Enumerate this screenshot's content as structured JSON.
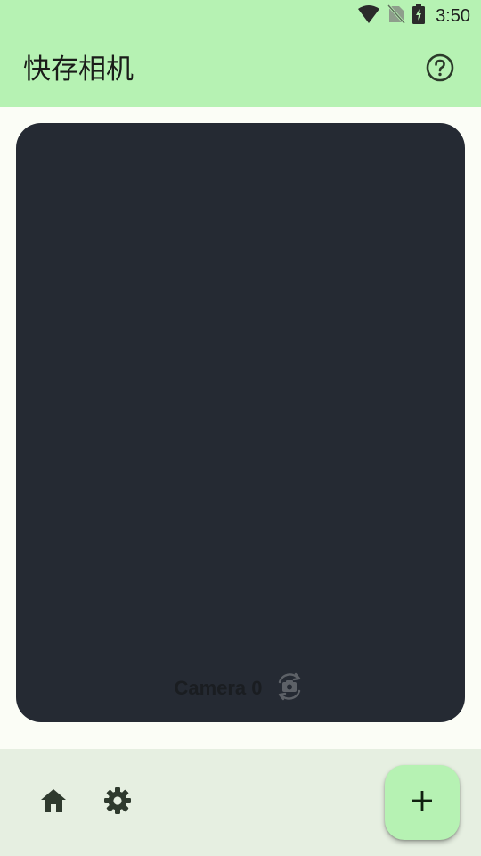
{
  "status_bar": {
    "time": "3:50",
    "icons": [
      "wifi-icon",
      "no-sim-icon",
      "battery-charging-icon"
    ]
  },
  "app_bar": {
    "title": "快存相机",
    "action_icon": "help-circle-icon"
  },
  "preview": {
    "camera_label": "Camera 0",
    "switch_icon": "switch-camera-icon"
  },
  "bottom_bar": {
    "nav_icons": [
      "home-icon",
      "settings-icon"
    ],
    "fab_icon": "plus-icon"
  },
  "colors": {
    "accent": "#b6f2b3",
    "preview_bg": "#252a33",
    "bottom_bar_bg": "#e6efe1",
    "page_bg": "#fbfdf6"
  }
}
